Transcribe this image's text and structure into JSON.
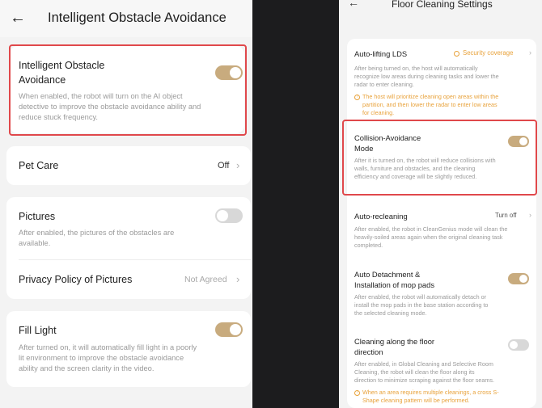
{
  "left": {
    "header": {
      "back_icon": "←",
      "title": "Intelligent Obstacle Avoidance"
    },
    "obstacle": {
      "title_line1": "Intelligent Obstacle",
      "title_line2": "Avoidance",
      "toggle": "on",
      "desc_line1": "When enabled, the robot will turn on the AI object",
      "desc_line2": "detective to improve the obstacle avoidance ability and",
      "desc_line3": "reduce stuck frequency."
    },
    "pet_care": {
      "title": "Pet Care",
      "value": "Off",
      "chevron": "›"
    },
    "pictures": {
      "title": "Pictures",
      "toggle": "off",
      "desc_line1": "After enabled, the pictures of the obstacles are",
      "desc_line2": "available."
    },
    "privacy": {
      "title": "Privacy Policy of Pictures",
      "value": "Not Agreed",
      "chevron": "›"
    },
    "fill_light": {
      "title": "Fill Light",
      "toggle": "on",
      "desc_line1": "After turned on, it will automatically fill light in a poorly",
      "desc_line2": "lit environment to improve the obstacle avoidance",
      "desc_line3": "ability and the screen clarity in the video."
    }
  },
  "right": {
    "header": {
      "back_icon": "←",
      "title": "Floor Cleaning Settings"
    },
    "lds": {
      "title": "Auto-lifting LDS",
      "value": "Security coverage",
      "chevron": "›",
      "desc_line1": "After being turned on, the host will automatically",
      "desc_line2": "recognize low areas during cleaning tasks and lower the",
      "desc_line3": "radar to enter cleaning.",
      "warn_icon": "!",
      "warn_line1": "The host will prioritize cleaning open areas within the",
      "warn_line2": "partition, and then lower the radar to enter low areas",
      "warn_line3": "for cleaning."
    },
    "collision": {
      "title_line1": "Collision-Avoidance",
      "title_line2": "Mode",
      "toggle": "on",
      "desc_line1": "After it is turned on, the robot will reduce collisions with",
      "desc_line2": "walls, furniture and obstacles, and the cleaning",
      "desc_line3": "efficiency and coverage will be slightly reduced."
    },
    "recleaning": {
      "title": "Auto-recleaning",
      "value": "Turn off",
      "chevron": "›",
      "desc_line1": "After enabled, the robot in CleanGenius mode will clean the",
      "desc_line2": "heavily-soiled areas again when the original cleaning task",
      "desc_line3": "completed."
    },
    "mop": {
      "title_line1": "Auto Detachment &",
      "title_line2": "Installation of mop pads",
      "toggle": "on",
      "desc_line1": "After enabled, the robot will automatically detach or",
      "desc_line2": "install the mop pads in the base station according to",
      "desc_line3": "the selected cleaning mode."
    },
    "floor_dir": {
      "title_line1": "Cleaning along the floor",
      "title_line2": "direction",
      "toggle": "off",
      "desc_line1": "After enabled, in Global Cleaning and Selective Room",
      "desc_line2": "Cleaning, the robot will clean the floor along its",
      "desc_line3": "direction to minimize scraping against the floor seams.",
      "warn_icon": "!",
      "warn_line1": "When an area requires multiple cleanings, a cross S-",
      "warn_line2": "Shape cleaning pattern will be performed."
    }
  },
  "colors": {
    "accent": "#c8ab7e",
    "highlight": "#e0484b",
    "warning": "#e8a23b"
  }
}
